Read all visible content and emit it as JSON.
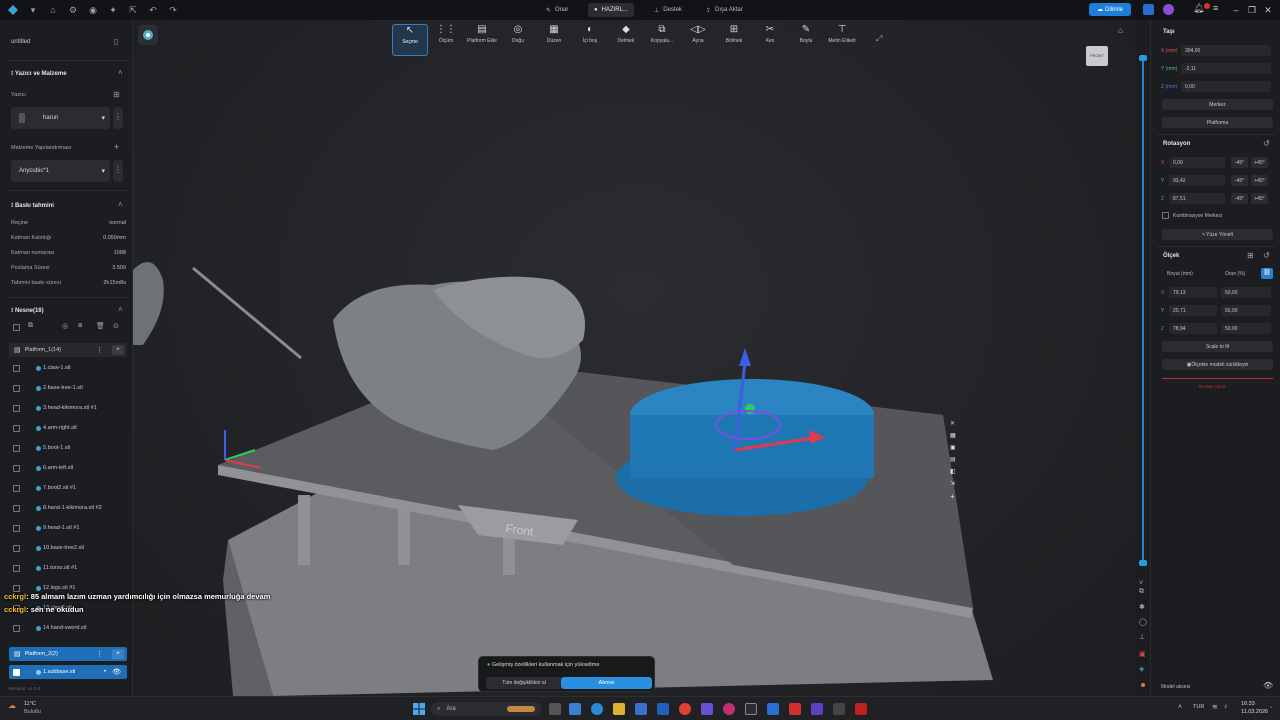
{
  "titlebar": {
    "tabs": [
      {
        "label": "Onar"
      },
      {
        "label": "HAZIRL..."
      },
      {
        "label": "Destek"
      },
      {
        "label": "Dışa Aktar"
      }
    ],
    "update_label": "Dilimle"
  },
  "left": {
    "project_title": "untitled",
    "printer_section": "Yazıcı ve Malzeme",
    "printer_label": "Yazıcı",
    "printer_value": "harun",
    "material_label": "Malzeme Yapılandırması",
    "material_value": "Anycubic*1",
    "estimate_section": "Baskı tahmini",
    "estimates": [
      {
        "k": "Reçine",
        "v": "normal"
      },
      {
        "k": "Katman Kalınlığı",
        "v": "0.050mm"
      },
      {
        "k": "Katman numarası",
        "v": "1088"
      },
      {
        "k": "Pozlama Süresi",
        "v": "3.500"
      },
      {
        "k": "Tahmini baskı süresi",
        "v": "2h15m8s"
      }
    ],
    "objects_section": "Nesne(16)",
    "platform1": "Platform_1(14)",
    "objects": [
      "1.claw-1.stl",
      "2.base-tree-1.stl",
      "3.head-kikimora.stl #1",
      "4.arm-right.stl",
      "5.boot-1.stl",
      "6.arm-left.stl",
      "7.boot2.stl #1",
      "8.hand-1-kikimora.stl #2",
      "9.head-1.stl #1",
      "10.base-tree2.stl",
      "11.torso.stl #1",
      "12.legs.stl #1",
      "13.claw2.stl",
      "14.hand-sword.stl"
    ],
    "platform2": "Platform_2(2)",
    "platform2_item": "1.subbase.stl",
    "version": "Versiyon: v1.0.0"
  },
  "toolbar": [
    {
      "label": "Seçme",
      "icon": "↖"
    },
    {
      "label": "Ölçüm",
      "icon": "⋮⋮"
    },
    {
      "label": "Platform Ekle",
      "icon": "▤"
    },
    {
      "label": "Doğu",
      "icon": "◎"
    },
    {
      "label": "Düzen",
      "icon": "▦"
    },
    {
      "label": "İçi boş",
      "icon": "◐"
    },
    {
      "label": "Delmek",
      "icon": "◆"
    },
    {
      "label": "Kopyala...",
      "icon": "⧉"
    },
    {
      "label": "Ayna",
      "icon": "◁▷"
    },
    {
      "label": "Bölmek",
      "icon": "⊞"
    },
    {
      "label": "Kes",
      "icon": "✂"
    },
    {
      "label": "Boyla",
      "icon": "✎"
    },
    {
      "label": "Metin Etiketi",
      "icon": "⊤"
    }
  ],
  "viewport": {
    "front_label": "Front",
    "cube_label": "FRONT"
  },
  "right": {
    "move_title": "Taşı",
    "move_x_label": "X (mm)",
    "move_x": "304,00",
    "move_y_label": "Y (mm)",
    "move_y": "-2,11",
    "move_z_label": "Z (mm)",
    "move_z": "0,00",
    "center_btn": "Merkez",
    "platform_btn": "Platforma",
    "rotate_title": "Rotasyon",
    "rot_x": "0,00",
    "rot_y": "93,42",
    "rot_z": "87,51",
    "minus45": "-45°",
    "plus45": "+45°",
    "combo_center": "Kombinasyon Merkezi",
    "face_orient": "Yüze Yönelt",
    "scale_title": "Ölçek",
    "size_label": "Boyut (mm)",
    "ratio_label": "Oran (%)",
    "sx": "79,13",
    "sy": "20,71",
    "sz": "78,94",
    "px": "50,00",
    "py": "50,00",
    "pz": "50,00",
    "fit_btn": "Scale to fit",
    "drag_scale": "Ölçekte modeli sürükleyin",
    "reset_text": "Bunları sıfırla",
    "bottom_label": "Model aksesi"
  },
  "chat": [
    {
      "user": "cckrgl",
      "msg": ": 85 almam lazım uzman yardımcılığı için olmazsa memurluğa devam"
    },
    {
      "user": "cckrgl",
      "msg": ": sen ne okudun"
    }
  ],
  "promo": {
    "text": "Gelişmiş özellikleri kullanmak için yükseltme",
    "btn1": "Tüm değişiklikleri al",
    "btn2": "Abone"
  },
  "taskbar": {
    "weather_temp": "11°C",
    "weather_desc": "Bulutlu",
    "search_placeholder": "Ara",
    "lang": "TUR",
    "time": "16:33",
    "date": "11.03.2026"
  }
}
